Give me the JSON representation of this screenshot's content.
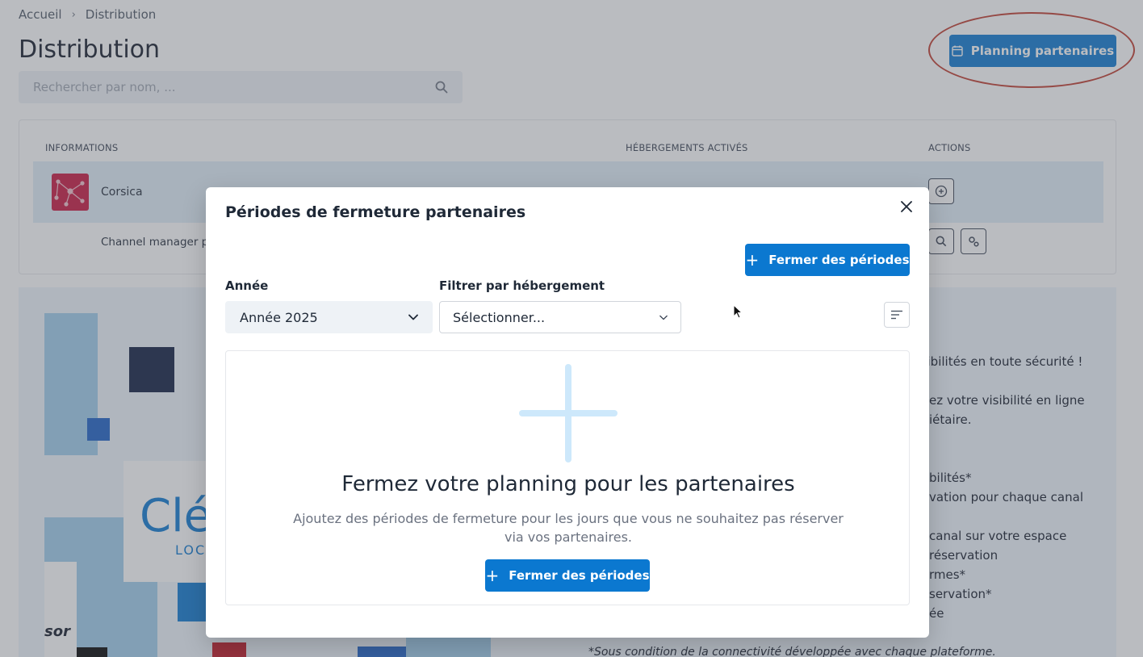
{
  "breadcrumb": {
    "home": "Accueil",
    "separator": "›",
    "current": "Distribution"
  },
  "page": {
    "title": "Distribution",
    "search_placeholder": "Rechercher par nom, ...",
    "planning_button": "Planning partenaires"
  },
  "table": {
    "headers": {
      "info": "INFORMATIONS",
      "activated": "HÉBERGEMENTS ACTIVÉS",
      "actions": "ACTIONS"
    },
    "rows": [
      {
        "name": "Corsica"
      },
      {
        "name": "Channel manager pa"
      }
    ]
  },
  "promo": {
    "logo_text": "Clé",
    "logo_sub": "LOC",
    "brand_fragment": "sor",
    "lines": [
      "nibilités en toute sécurité !",
      "ez votre visibilité en ligne",
      "iétaire.",
      "bilités*",
      "vation pour chaque canal",
      "canal sur votre espace",
      "réservation",
      "rmes*",
      "servation*",
      "ée"
    ],
    "footnote": "*Sous condition de la connectivité développée avec chaque plateforme."
  },
  "modal": {
    "title": "Périodes de fermeture partenaires",
    "top_button": "Fermer des périodes",
    "year_label": "Année",
    "year_value": "Année 2025",
    "filter_label": "Filtrer par hébergement",
    "filter_placeholder": "Sélectionner...",
    "empty_title": "Fermez votre planning pour les partenaires",
    "empty_description": "Ajoutez des périodes de fermeture pour les jours que vous ne souhaitez pas réserver via vos partenaires.",
    "empty_button": "Fermer des périodes"
  },
  "colors": {
    "primary": "#0b78d0",
    "annotation": "#c0392b",
    "empty_plus": "#cde8fb",
    "brand_logo": "#c8133d"
  }
}
